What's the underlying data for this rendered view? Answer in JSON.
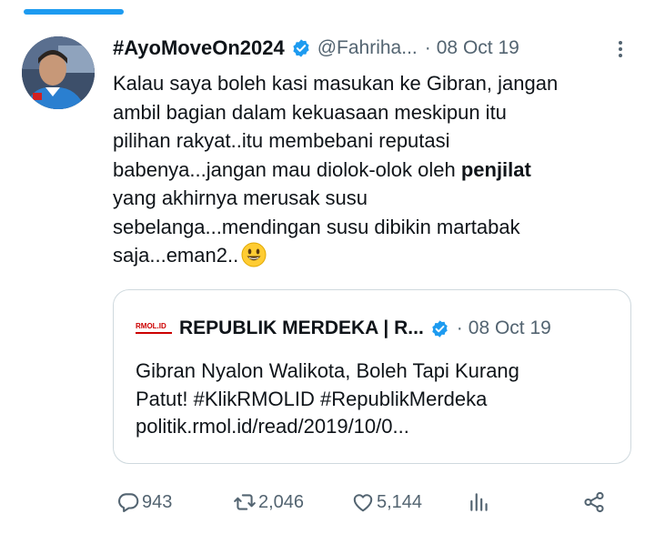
{
  "tweet": {
    "display_name": "#AyoMoveOn2024",
    "handle": "@Fahriha...",
    "separator": "·",
    "date": "08 Oct 19",
    "text_lines": [
      "Kalau saya boleh kasi masukan ke Gibran, jangan",
      "ambil bagian dalam kekuasaan meskipun itu",
      "pilihan rakyat..itu membebani reputasi",
      "babenya...jangan mau diolok-olok oleh ",
      "yang akhirnya merusak susu",
      "sebelanga...mendingan susu dibikin martabak",
      "saja...eman2.."
    ],
    "bold_word": "penjilat",
    "emoji": "smiling-face-emoji"
  },
  "quote": {
    "avatar_text": "RMOL.ID",
    "display_name": "REPUBLIK MERDEKA | R...",
    "separator": "·",
    "date": "08 Oct 19",
    "text_lines": [
      "Gibran Nyalon Walikota, Boleh Tapi Kurang",
      "Patut! #KlikRMOLID #RepublikMerdeka",
      "politik.rmol.id/read/2019/10/0..."
    ]
  },
  "actions": {
    "replies": "943",
    "retweets": "2,046",
    "likes": "5,144"
  },
  "icons": {
    "verified": "verified-badge-icon",
    "more": "more-options-icon",
    "reply": "reply-icon",
    "retweet": "retweet-icon",
    "like": "heart-icon",
    "views": "views-chart-icon",
    "share": "share-icon"
  },
  "colors": {
    "accent": "#1d9bf0",
    "text": "#0f1419",
    "secondary": "#536471",
    "border": "#cfd9de"
  }
}
